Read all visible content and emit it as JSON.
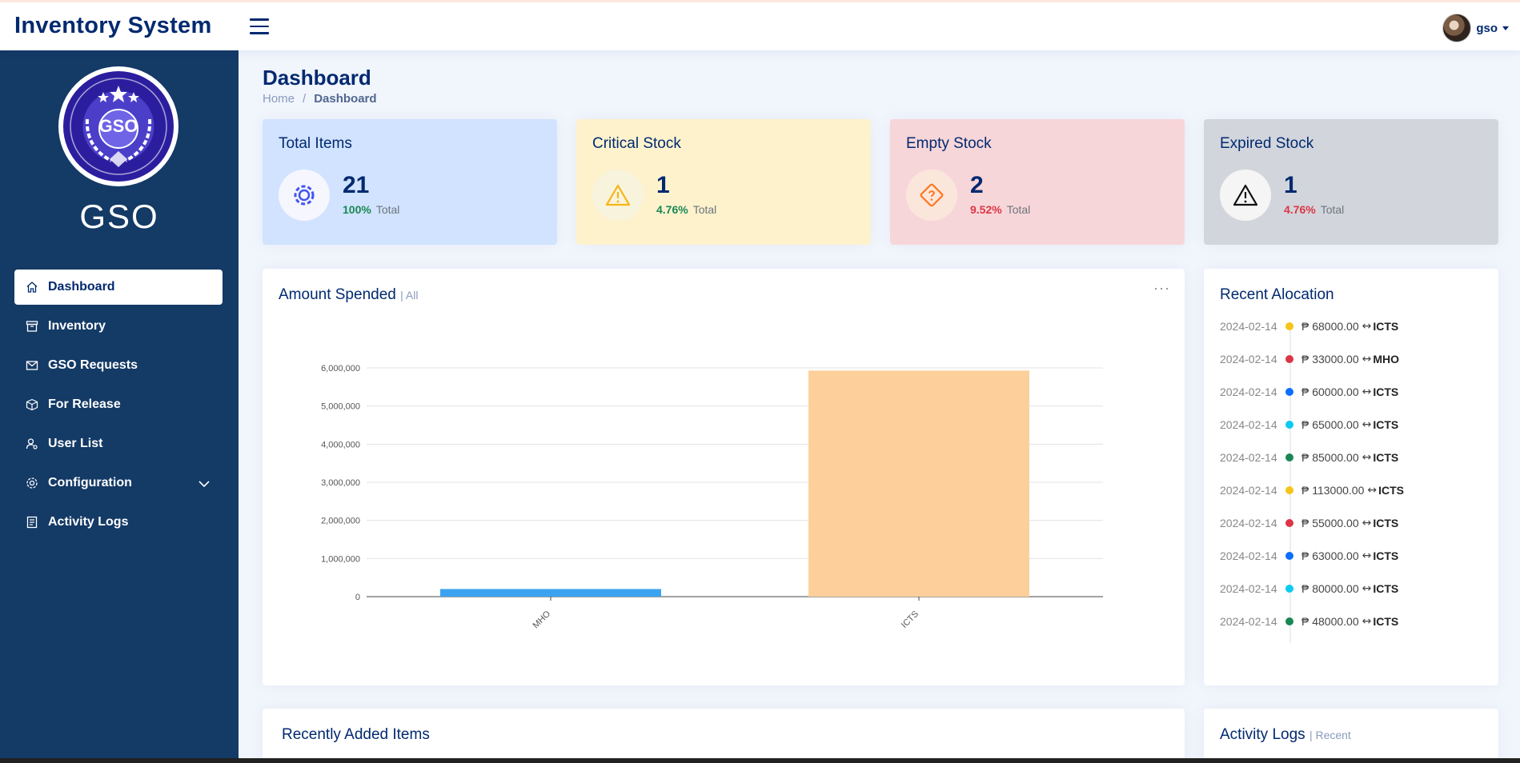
{
  "header": {
    "app_title": "Inventory System",
    "user_name": "gso"
  },
  "sidebar": {
    "brand": "GSO",
    "logo_text": "GSO",
    "items": [
      {
        "label": "Dashboard",
        "icon": "house-icon",
        "active": true
      },
      {
        "label": "Inventory",
        "icon": "archive-icon"
      },
      {
        "label": "GSO Requests",
        "icon": "envelope-icon"
      },
      {
        "label": "For Release",
        "icon": "box-icon"
      },
      {
        "label": "User List",
        "icon": "person-gear-icon"
      },
      {
        "label": "Configuration",
        "icon": "gear-icon",
        "has_chevron": true
      },
      {
        "label": "Activity Logs",
        "icon": "journal-icon"
      }
    ]
  },
  "page": {
    "title": "Dashboard",
    "breadcrumb": [
      "Home",
      "/",
      "Dashboard"
    ]
  },
  "stats": [
    {
      "title": "Total Items",
      "value": "21",
      "pct": "100%",
      "label": "Total",
      "bg": "#d1e3fe",
      "pct_color": "#198754",
      "icon": "gear-icon"
    },
    {
      "title": "Critical Stock",
      "value": "1",
      "pct": "4.76%",
      "label": "Total",
      "bg": "#fdf2cc",
      "pct_color": "#198754",
      "icon": "warning-icon"
    },
    {
      "title": "Empty Stock",
      "value": "2",
      "pct": "9.52%",
      "label": "Total",
      "bg": "#f7d6d9",
      "pct_color": "#dc3545",
      "icon": "sign-question-icon"
    },
    {
      "title": "Expired Stock",
      "value": "1",
      "pct": "4.76%",
      "label": "Total",
      "bg": "#d2d6dc",
      "pct_color": "#dc3545",
      "icon": "danger-icon"
    }
  ],
  "amount_chart": {
    "title": "Amount Spended",
    "filter": "| All",
    "menu": "···"
  },
  "chart_data": {
    "type": "bar",
    "categories": [
      "MHO",
      "ICTS"
    ],
    "values": [
      200000,
      5930000
    ],
    "colors": [
      "#3ba3f0",
      "#fdd09b"
    ],
    "ylim": [
      0,
      6000000
    ],
    "yticks": [
      "0",
      "1,000,000",
      "2,000,000",
      "3,000,000",
      "4,000,000",
      "5,000,000",
      "6,000,000"
    ],
    "grid": true
  },
  "recent_allocation": {
    "title": "Recent Alocation",
    "items": [
      {
        "date": "2024-02-14",
        "amount": "₱ 68000.00",
        "arrow": "↔",
        "dept": "ICTS",
        "color": "#f5c518"
      },
      {
        "date": "2024-02-14",
        "amount": "₱ 33000.00",
        "arrow": "↔",
        "dept": "MHO",
        "color": "#dc3545"
      },
      {
        "date": "2024-02-14",
        "amount": "₱ 60000.00",
        "arrow": "↔",
        "dept": "ICTS",
        "color": "#0d6efd"
      },
      {
        "date": "2024-02-14",
        "amount": "₱ 65000.00",
        "arrow": "↔",
        "dept": "ICTS",
        "color": "#0dcaf0"
      },
      {
        "date": "2024-02-14",
        "amount": "₱ 85000.00",
        "arrow": "↔",
        "dept": "ICTS",
        "color": "#198754"
      },
      {
        "date": "2024-02-14",
        "amount": "₱ 113000.00",
        "arrow": "↔",
        "dept": "ICTS",
        "color": "#f5c518"
      },
      {
        "date": "2024-02-14",
        "amount": "₱ 55000.00",
        "arrow": "↔",
        "dept": "ICTS",
        "color": "#dc3545"
      },
      {
        "date": "2024-02-14",
        "amount": "₱ 63000.00",
        "arrow": "↔",
        "dept": "ICTS",
        "color": "#0d6efd"
      },
      {
        "date": "2024-02-14",
        "amount": "₱ 80000.00",
        "arrow": "↔",
        "dept": "ICTS",
        "color": "#0dcaf0"
      },
      {
        "date": "2024-02-14",
        "amount": "₱ 48000.00",
        "arrow": "↔",
        "dept": "ICTS",
        "color": "#198754"
      }
    ]
  },
  "recently_added": {
    "title": "Recently Added Items"
  },
  "activity_logs": {
    "title": "Activity Logs",
    "filter": "| Recent"
  }
}
